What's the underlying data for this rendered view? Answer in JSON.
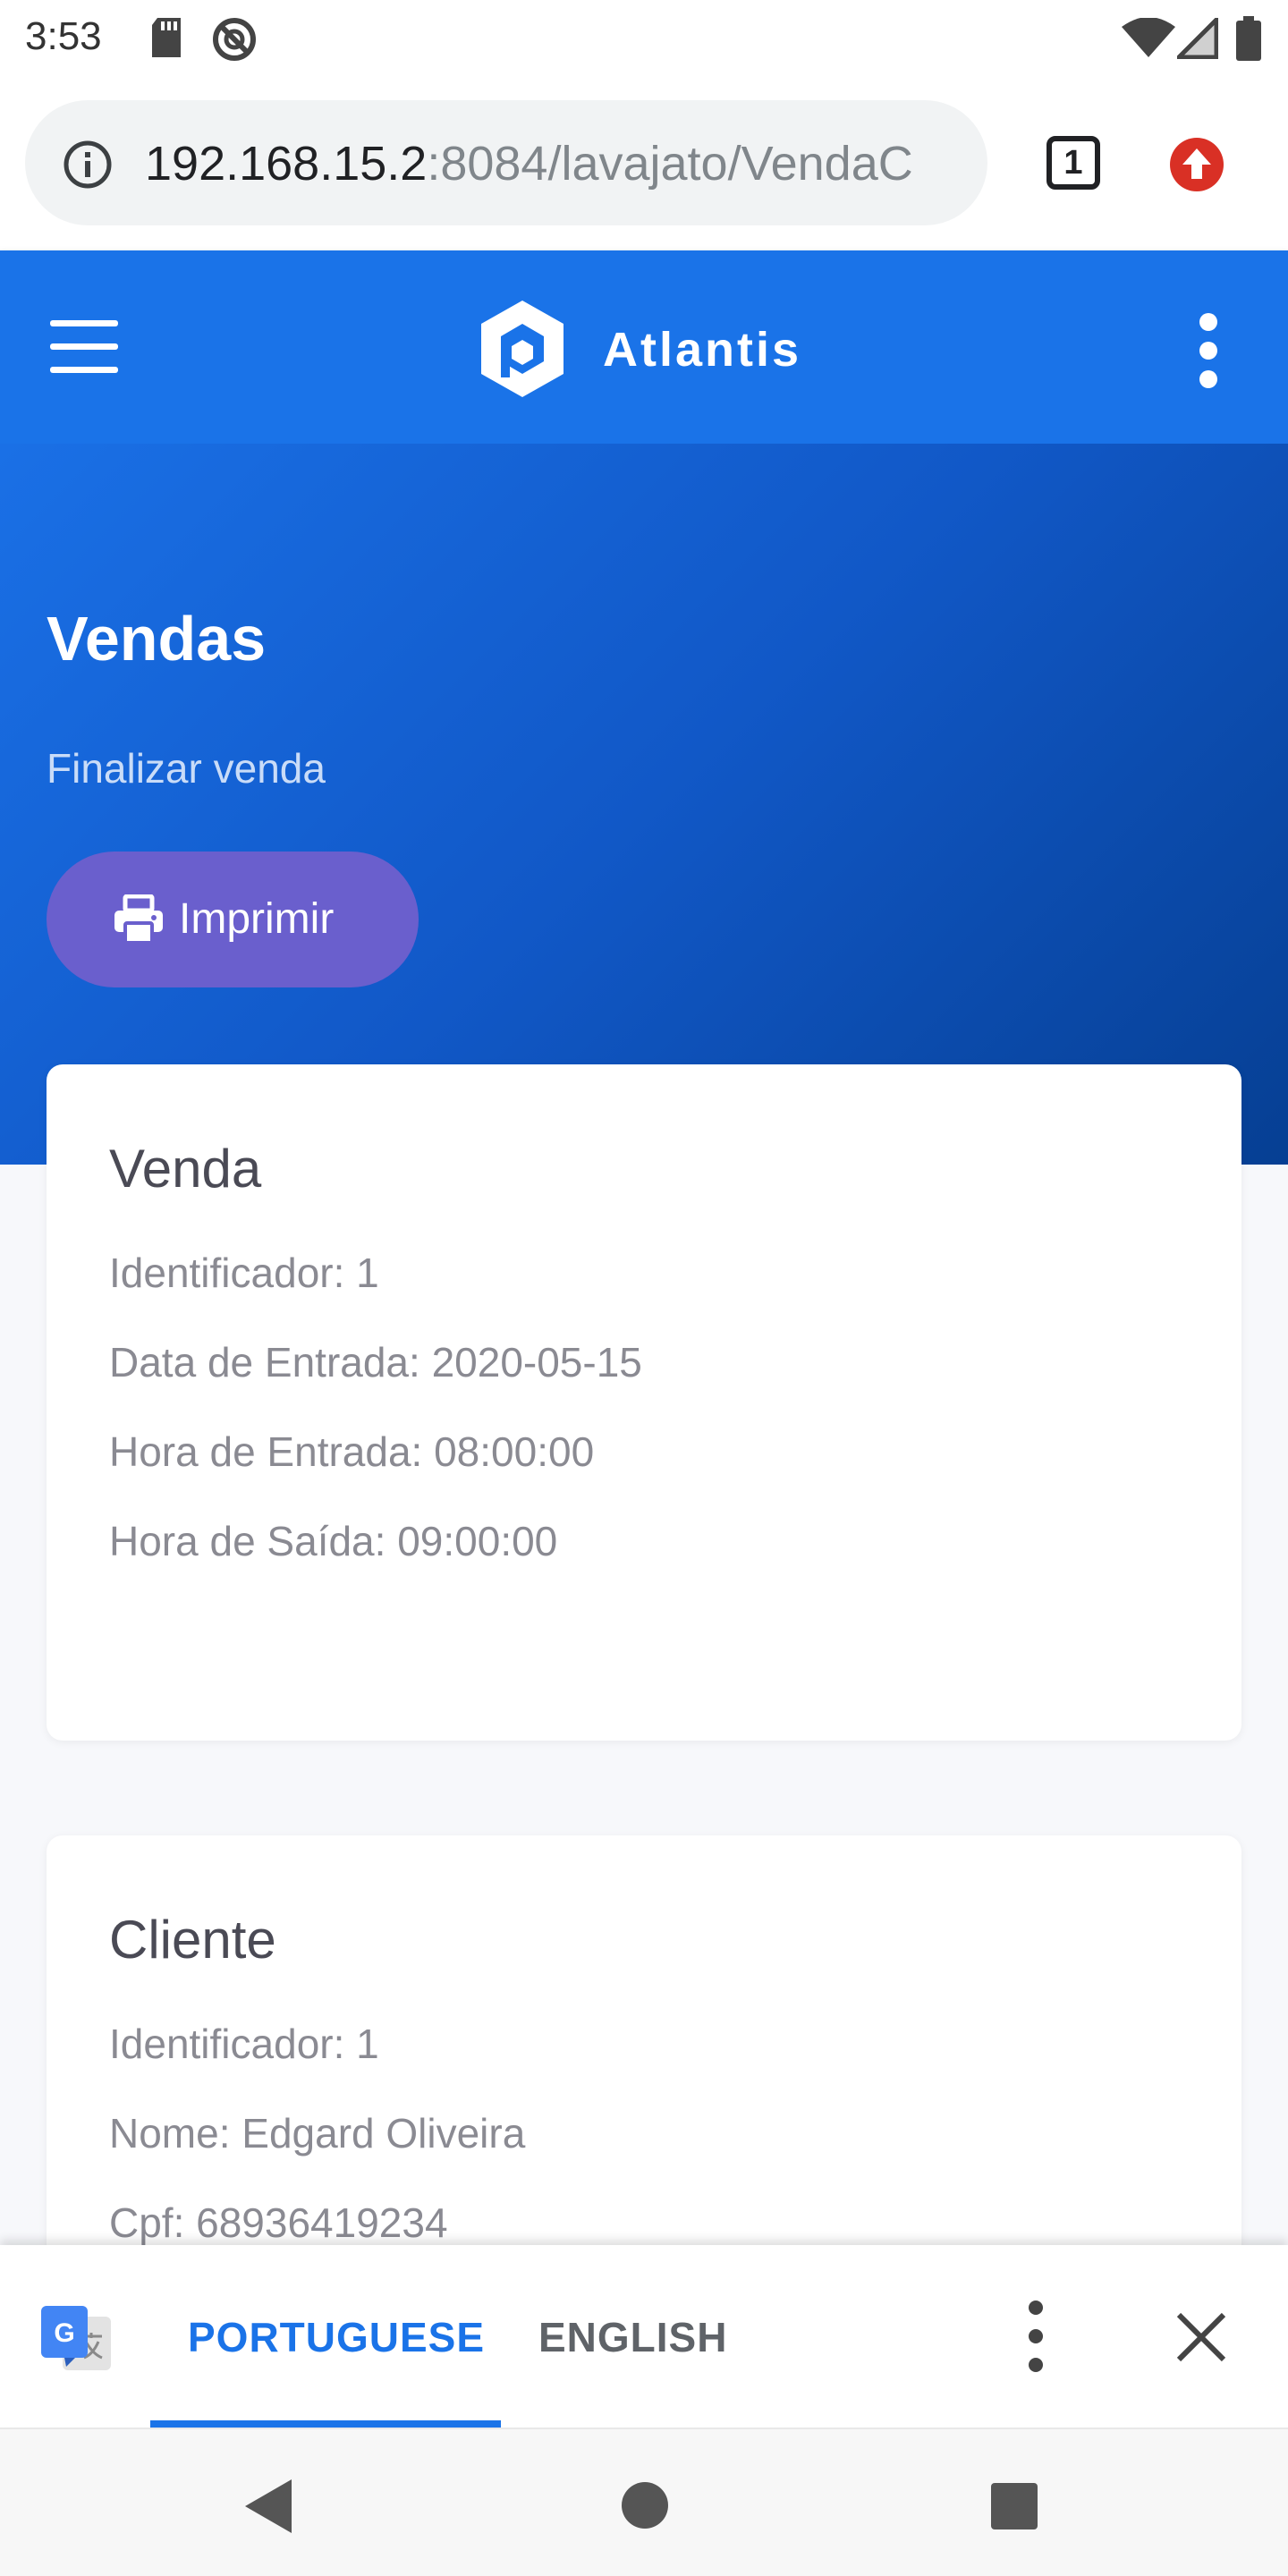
{
  "status_bar": {
    "time": "3:53"
  },
  "browser": {
    "url_host": "192.168.15.2",
    "url_rest": ":8084/lavajato/VendaC",
    "tab_count": "1"
  },
  "app": {
    "brand": "Atlantis"
  },
  "hero": {
    "title": "Vendas",
    "subtitle": "Finalizar venda",
    "print_label": "Imprimir"
  },
  "venda_card": {
    "title": "Venda",
    "lines": [
      "Identificador: 1",
      "Data de Entrada: 2020-05-15",
      "Hora de Entrada: 08:00:00",
      "Hora de Saída: 09:00:00"
    ]
  },
  "cliente_card": {
    "title": "Cliente",
    "lines": [
      "Identificador: 1",
      "Nome: Edgard Oliveira",
      "Cpf: 68936419234"
    ]
  },
  "translate_bar": {
    "lang_source": "PORTUGUESE",
    "lang_target": "ENGLISH"
  },
  "colors": {
    "primary": "#1a73e8",
    "print_button": "#6a5fcd",
    "update_red": "#d93025"
  }
}
